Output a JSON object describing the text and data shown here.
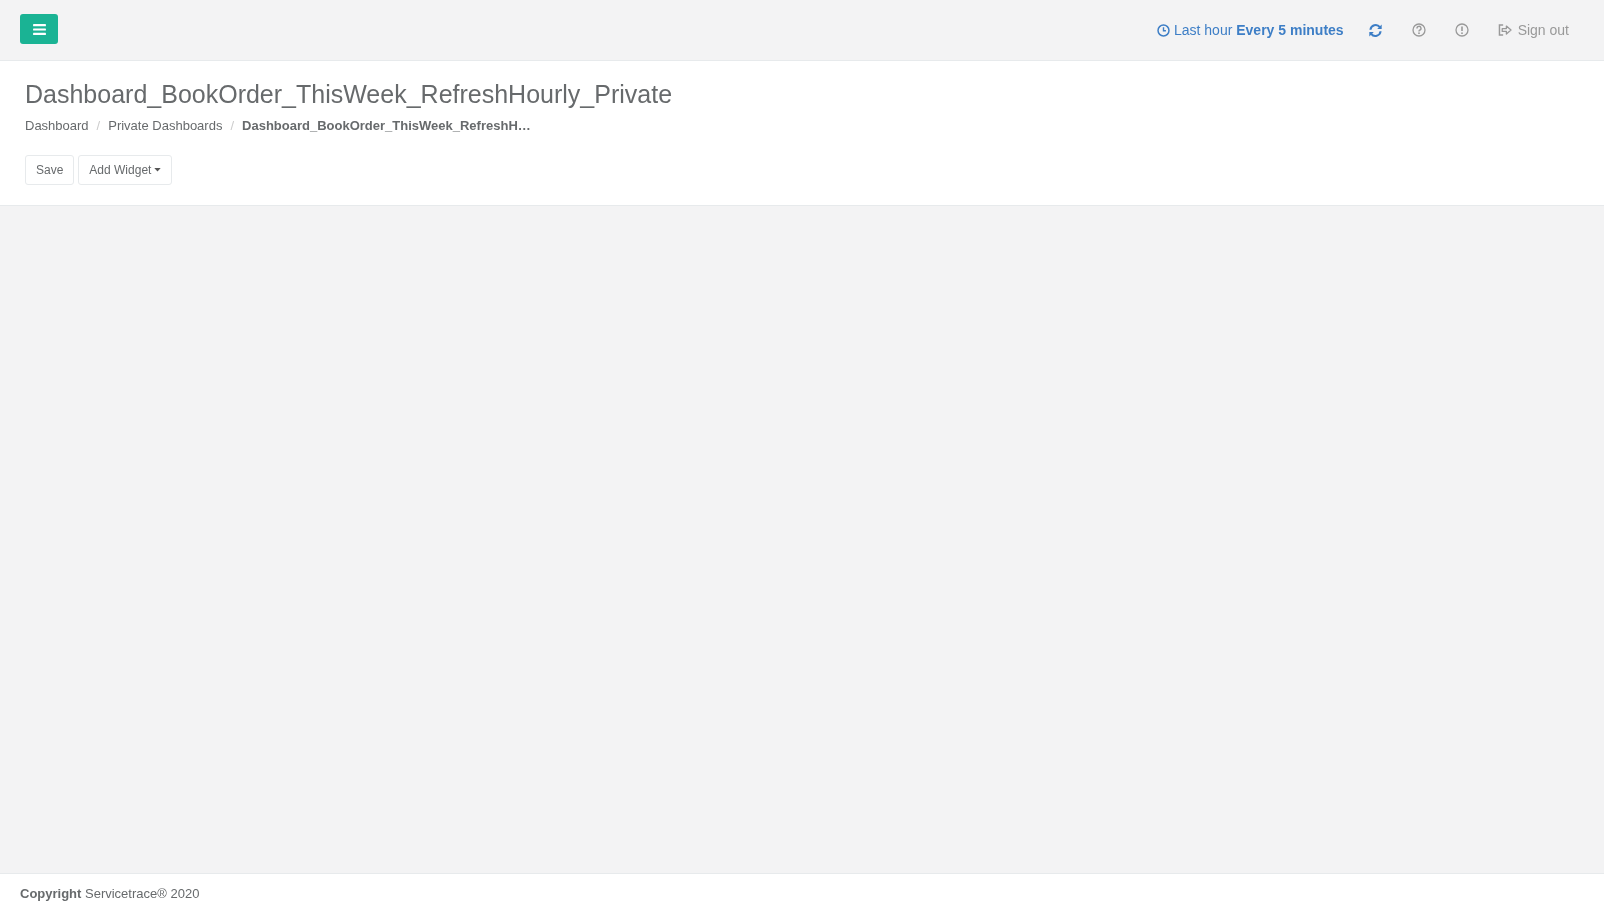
{
  "top_bar": {
    "time_range": "Last hour **Every 5 minutes**",
    "sign_out": "Sign out"
  },
  "page_header": {
    "title": "Dashboard_BookOrder_ThisWeek_RefreshHourly_Private",
    "breadcrumb": [
      {
        "label": "Dashboard",
        "current": false
      },
      {
        "label": "Private Dashboards",
        "current": false
      },
      {
        "label": "Dashboard_BookOrder_ThisWeek_RefreshH…",
        "current": true
      }
    ],
    "separator": "/",
    "buttons": [
      {
        "label": "Save",
        "kind": "plain"
      },
      {
        "label": "Add Widget",
        "kind": "dropdown"
      }
    ]
  },
  "footer": {
    "text": "**Copyright** Servicetrace® 2020"
  }
}
